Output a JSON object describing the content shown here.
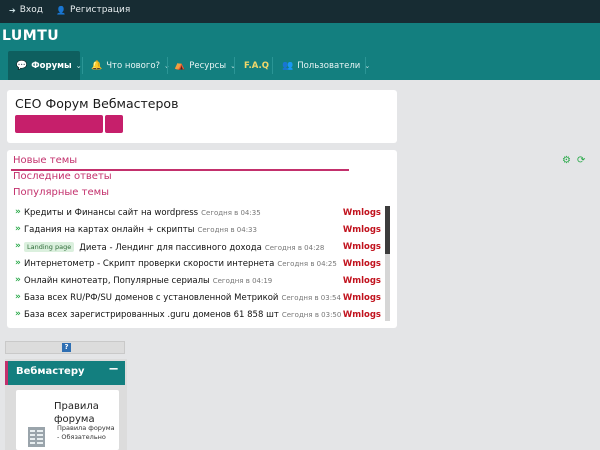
{
  "topbar": {
    "login_label": "Вход",
    "register_label": "Регистрация"
  },
  "header": {
    "logo": "LUMTU"
  },
  "nav": {
    "items": [
      {
        "label": "Форумы",
        "icon": "chat-icon"
      },
      {
        "label": "Что нового?",
        "icon": "bell-icon"
      },
      {
        "label": "Ресурсы",
        "icon": "box-icon"
      },
      {
        "label": "F.A.Q",
        "icon": ""
      },
      {
        "label": "Пользователи",
        "icon": "users-icon"
      }
    ]
  },
  "title_panel": {
    "title": "СЕО Форум Вебмастеров"
  },
  "topics": {
    "tabs": [
      "Новые темы",
      "Последние ответы",
      "Популярные темы"
    ],
    "rows": [
      {
        "title": "Кредиты и Финансы сайт на wordpress",
        "tag": "",
        "time": "Сегодня в 04:35",
        "author": "Wmlogs"
      },
      {
        "title": "Гадания на картах онлайн + скрипты",
        "tag": "",
        "time": "Сегодня в 04:33",
        "author": "Wmlogs"
      },
      {
        "title": "Диета - Лендинг для пассивного дохода",
        "tag": "Landing page",
        "time": "Сегодня в 04:28",
        "author": "Wmlogs"
      },
      {
        "title": "Интернетометр - Скрипт проверки скорости интернета",
        "tag": "",
        "time": "Сегодня в 04:25",
        "author": "Wmlogs"
      },
      {
        "title": "Онлайн кинотеатр, Популярные сериалы",
        "tag": "",
        "time": "Сегодня в 04:19",
        "author": "Wmlogs"
      },
      {
        "title": "База всех RU/РФ/SU доменов с установленной Метрикой",
        "tag": "",
        "time": "Сегодня в 03:54",
        "author": "Wmlogs"
      },
      {
        "title": "База всех зарегистрированных .guru доменов 61 858 шт",
        "tag": "",
        "time": "Сегодня в 03:50",
        "author": "Wmlogs"
      }
    ]
  },
  "sidebar": {
    "category_title": "Вебмастеру",
    "collapse_label": "−",
    "forum_title": "Правила форума",
    "forum_desc": "Правила форума - Обязательно"
  },
  "colors": {
    "teal": "#137f7f",
    "dark": "#172c33",
    "accent": "#c3306c",
    "author": "#c1121d"
  }
}
